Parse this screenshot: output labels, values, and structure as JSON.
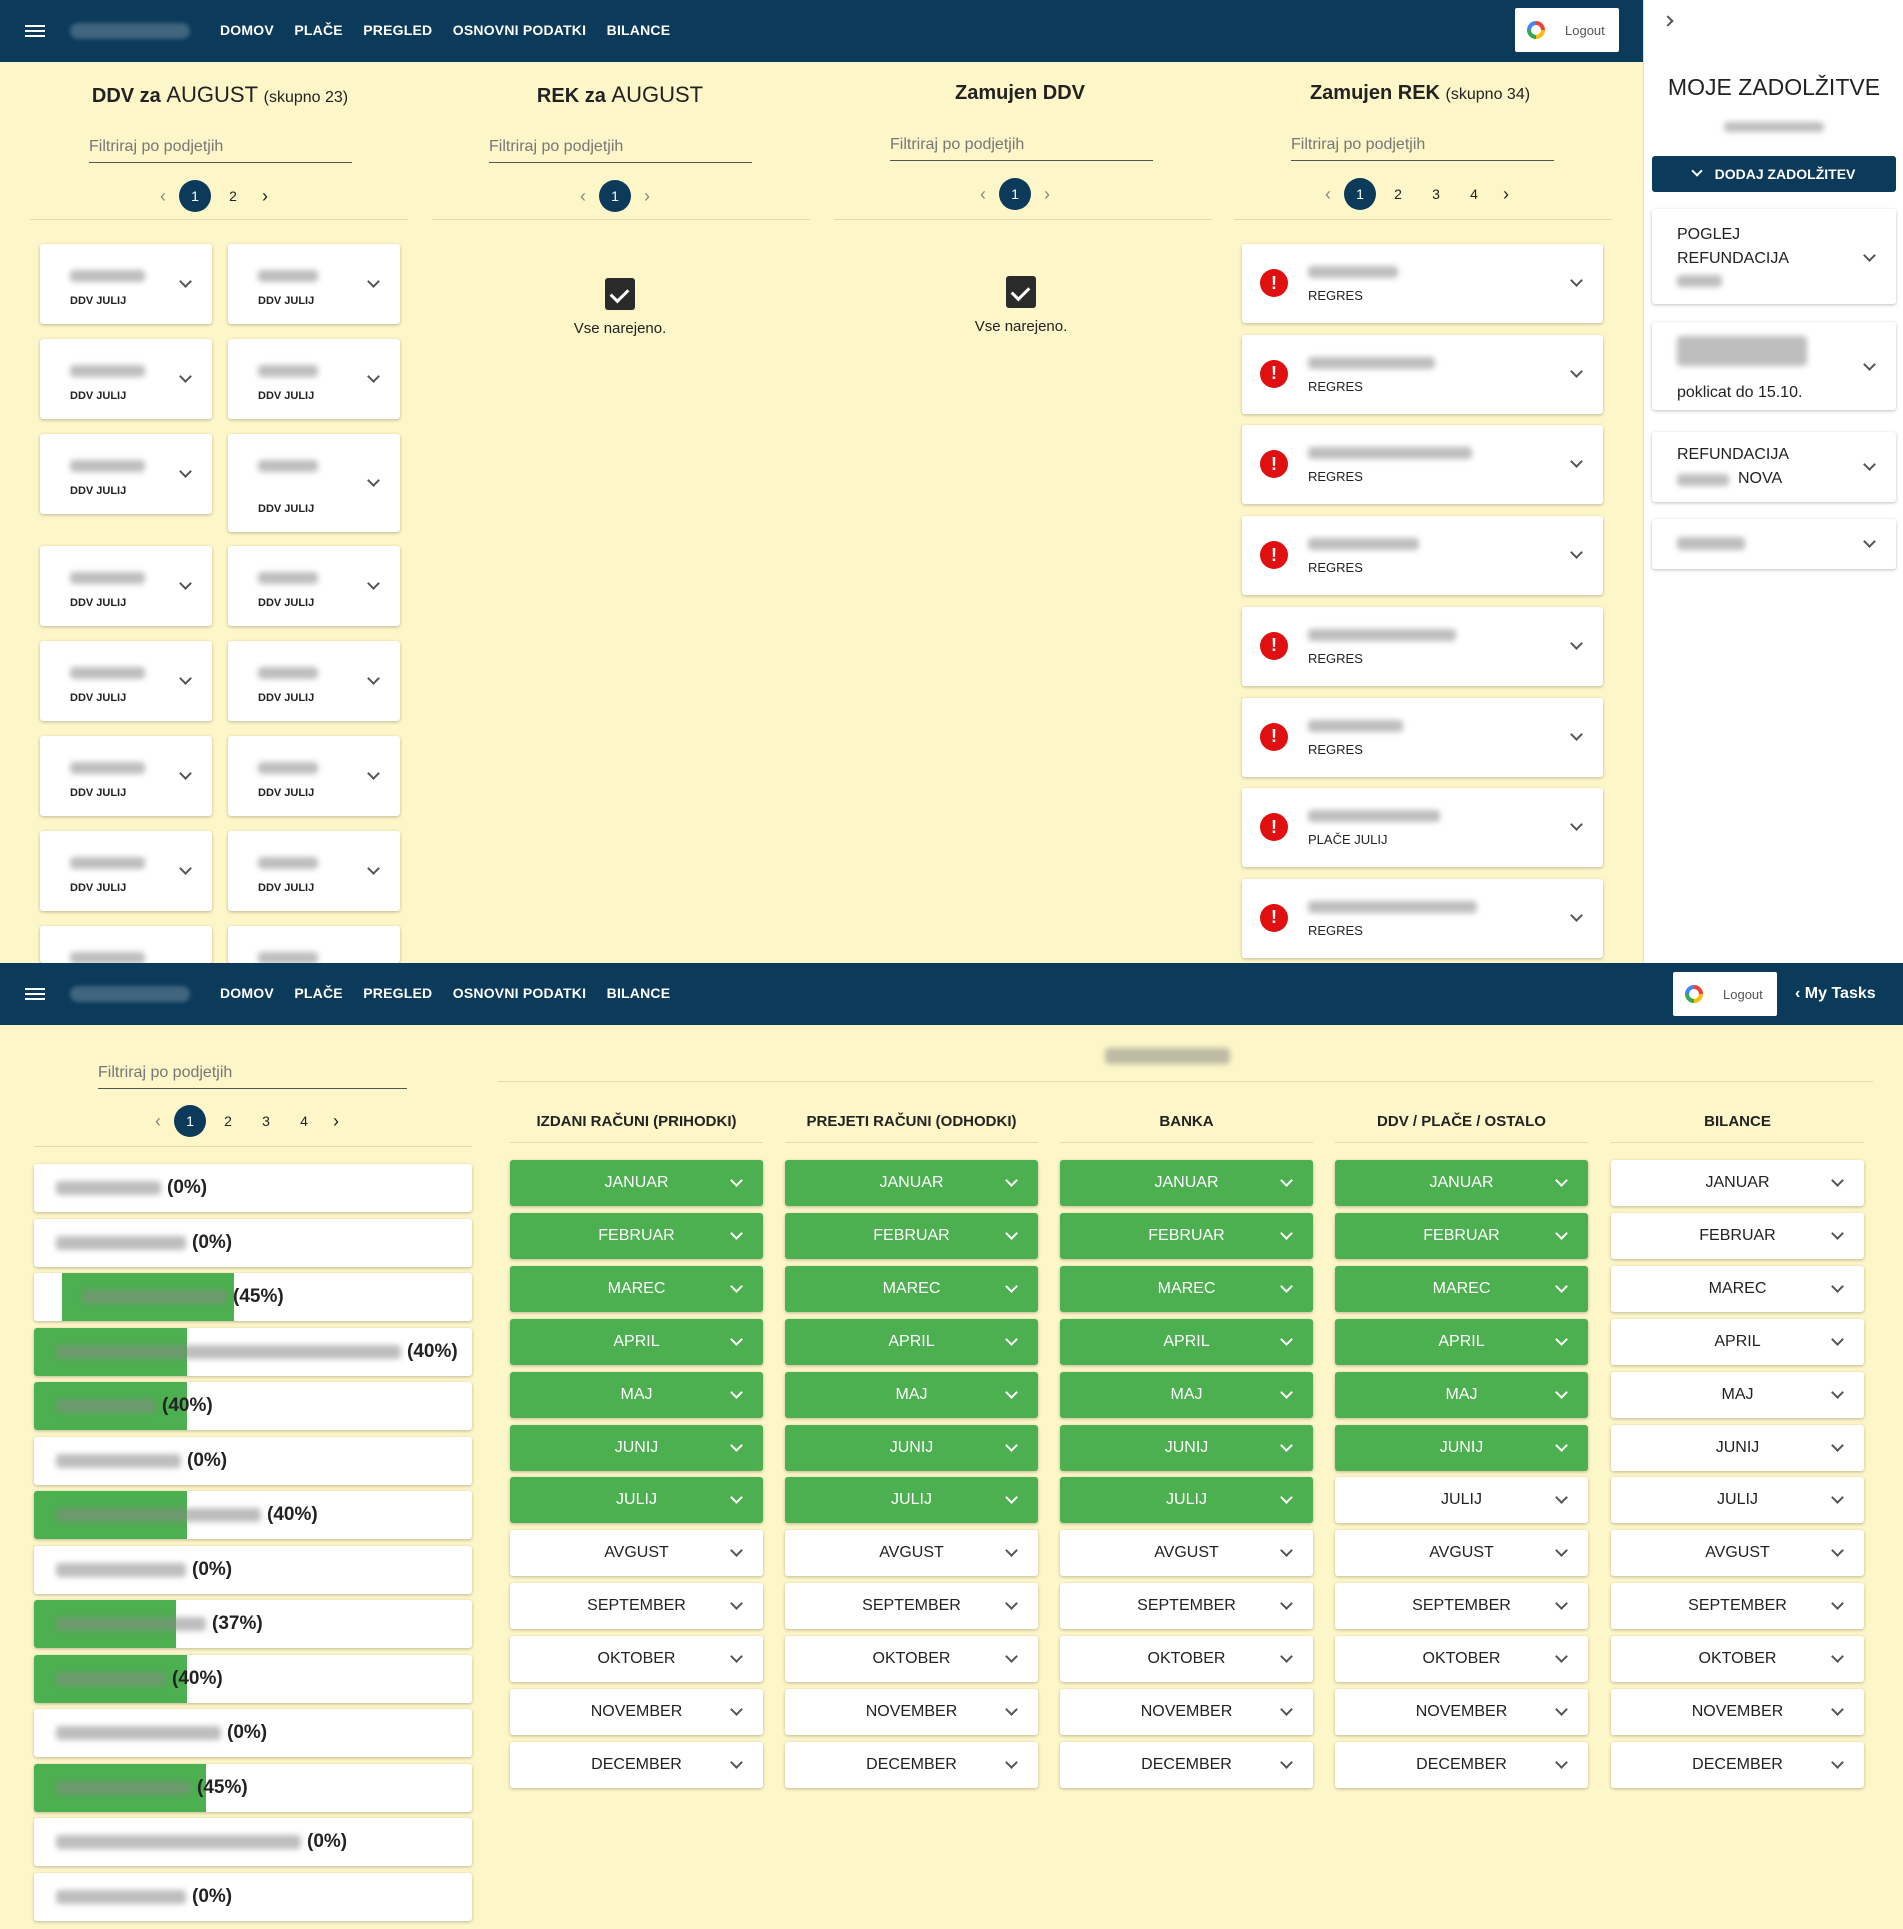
{
  "nav": {
    "items": [
      "DOMOV",
      "PLAČE",
      "PREGLED",
      "OSNOVNI PODATKI",
      "BILANCE"
    ],
    "logout": "Logout",
    "my_tasks": "My Tasks"
  },
  "top": {
    "filter_placeholder": "Filtriraj po podjetjih",
    "columns": [
      {
        "title": "DDV za",
        "title_month": "AUGUST",
        "subtitle": "(skupno 23)",
        "pages": [
          "1",
          "2"
        ]
      },
      {
        "title": "REK za",
        "title_month": "AUGUST",
        "subtitle": "",
        "pages": [
          "1"
        ]
      },
      {
        "title": "Zamujen DDV",
        "title_month": "",
        "subtitle": "",
        "pages": [
          "1"
        ]
      },
      {
        "title": "Zamujen REK",
        "title_month": "",
        "subtitle": "(skupno 34)",
        "pages": [
          "1",
          "2",
          "3",
          "4"
        ]
      }
    ],
    "done_text": "Vse narejeno.",
    "ddv_label": "DDV JULIJ",
    "rek_labels": [
      "REGRES",
      "REGRES",
      "REGRES",
      "REGRES",
      "REGRES",
      "REGRES",
      "PLAČE JULIJ",
      "REGRES"
    ]
  },
  "tasks_panel": {
    "title": "MOJE ZADOLŽITVE",
    "add_button": "DODAJ ZADOLŽITEV",
    "tasks": [
      {
        "line1": "POGLEJ",
        "line2": "REFUNDACIJA"
      },
      {
        "line1": "poklicat do 15.10.",
        "line2": ""
      },
      {
        "line1": "REFUNDACIJA",
        "line2": "NOVA"
      },
      {
        "line1": "",
        "line2": ""
      }
    ]
  },
  "bottom": {
    "filter_placeholder": "Filtriraj po podjetjih",
    "pages": [
      "1",
      "2",
      "3",
      "4"
    ],
    "companies": [
      {
        "pct_text": "(0%)",
        "progress": 0
      },
      {
        "pct_text": "(0%)",
        "progress": 0
      },
      {
        "pct_text": "(45%)",
        "progress": 45
      },
      {
        "pct_text": "(40%)",
        "progress": 40
      },
      {
        "pct_text": "(40%)",
        "progress": 40
      },
      {
        "pct_text": "(0%)",
        "progress": 0
      },
      {
        "pct_text": "(40%)",
        "progress": 40
      },
      {
        "pct_text": "(0%)",
        "progress": 0
      },
      {
        "pct_text": "(37%)",
        "progress": 37
      },
      {
        "pct_text": "(40%)",
        "progress": 40
      },
      {
        "pct_text": "(0%)",
        "progress": 0
      },
      {
        "pct_text": "(45%)",
        "progress": 45
      },
      {
        "pct_text": "(0%)",
        "progress": 0
      },
      {
        "pct_text": "(0%)",
        "progress": 0
      }
    ],
    "month_columns": [
      {
        "title": "IZDANI RAČUNI (PRIHODKI)",
        "done_months": 7
      },
      {
        "title": "PREJETI RAČUNI (ODHODKI)",
        "done_months": 7
      },
      {
        "title": "BANKA",
        "done_months": 7
      },
      {
        "title": "DDV / PLAČE / OSTALO",
        "done_months": 6
      },
      {
        "title": "BILANCE",
        "done_months": 0
      }
    ],
    "months": [
      "JANUAR",
      "FEBRUAR",
      "MAREC",
      "APRIL",
      "MAJ",
      "JUNIJ",
      "JULIJ",
      "AVGUST",
      "SEPTEMBER",
      "OKTOBER",
      "NOVEMBER",
      "DECEMBER"
    ],
    "colors": {
      "done": "#4caf50",
      "header": "#0b3a5b",
      "alert": "#e01010"
    }
  }
}
